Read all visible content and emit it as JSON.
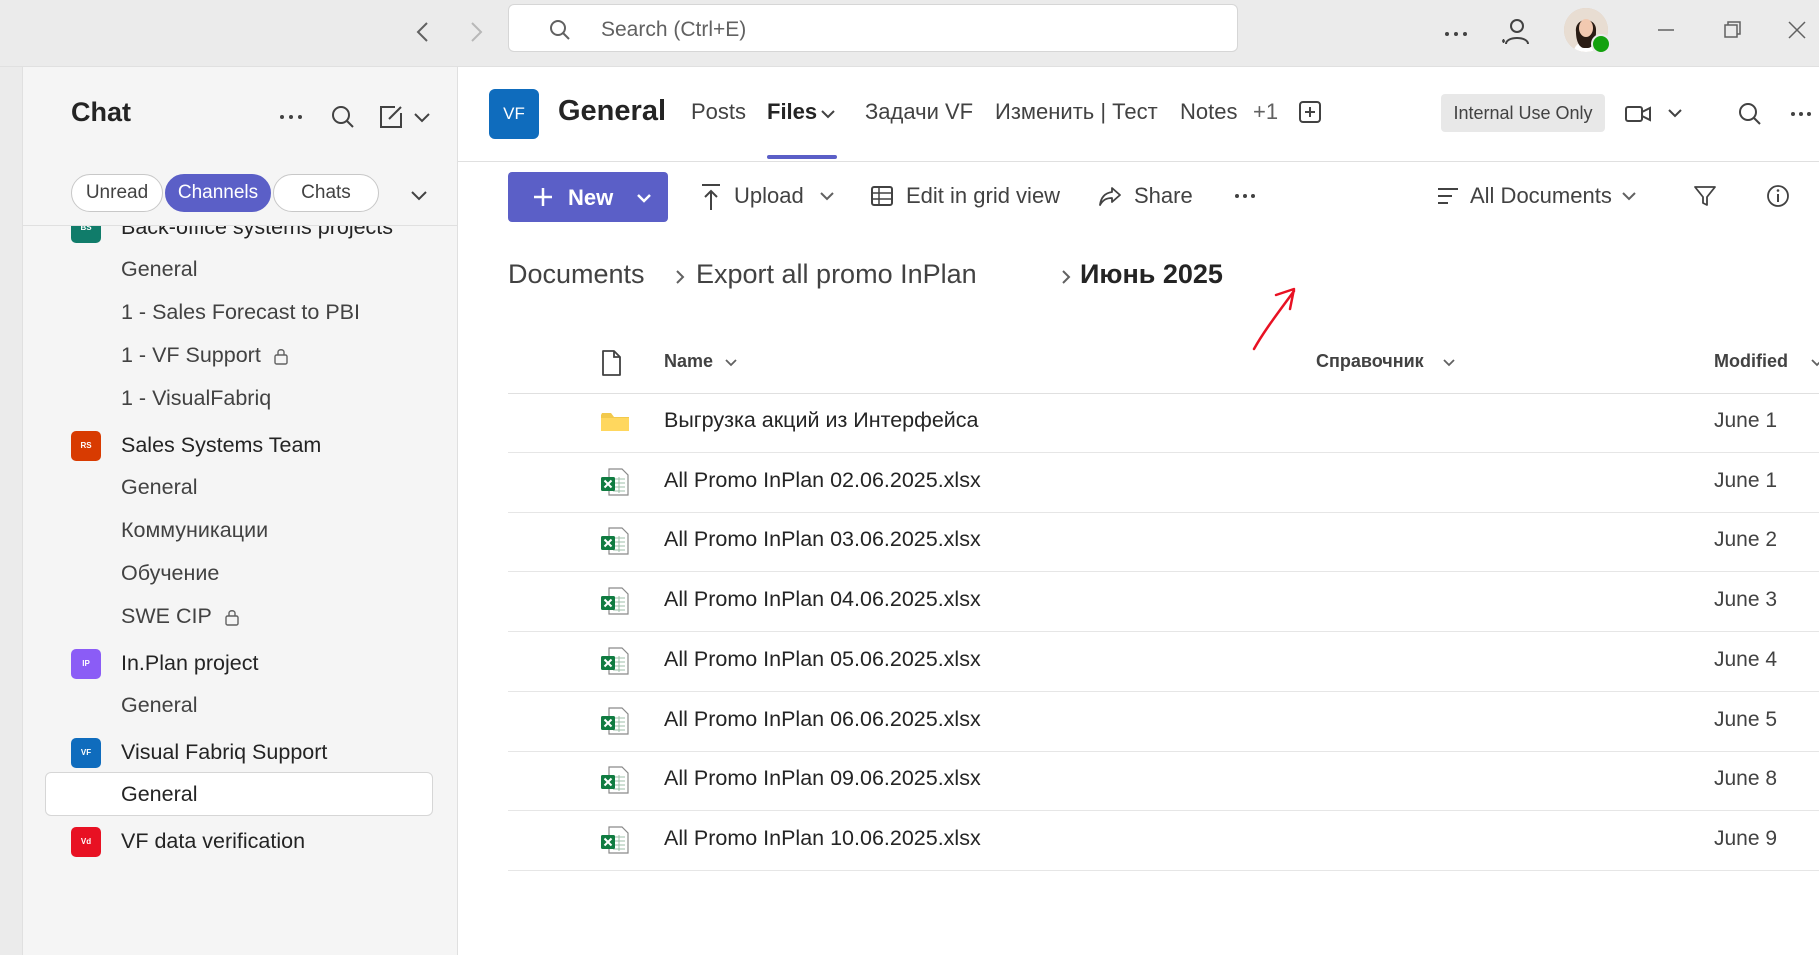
{
  "titlebar": {
    "search_placeholder": "Search (Ctrl+E)",
    "icons": [
      "back-arrow-icon",
      "forward-arrow-icon",
      "search-icon",
      "more-icon",
      "people-icon",
      "avatar",
      "minimize-icon",
      "maximize-icon",
      "close-icon"
    ]
  },
  "sidebar": {
    "title": "Chat",
    "filters": {
      "unread": "Unread",
      "channels": "Channels",
      "chats": "Chats",
      "active": "Channels"
    },
    "teams": [
      {
        "name": "Back-office systems projects",
        "badge": "BS",
        "color": "#107c6a",
        "channels": [
          {
            "name": "General"
          },
          {
            "name": "1 - Sales Forecast to PBI"
          },
          {
            "name": "1 - VF Support",
            "locked": true
          },
          {
            "name": "1 - VisualFabriq"
          }
        ]
      },
      {
        "name": "Sales Systems Team",
        "badge": "RS",
        "color": "#d83b01",
        "channels": [
          {
            "name": "General"
          },
          {
            "name": "Коммуникации"
          },
          {
            "name": "Обучение"
          },
          {
            "name": "SWE CIP",
            "locked": true
          }
        ]
      },
      {
        "name": "In.Plan project",
        "badge": "IP",
        "color": "#8b5cf6",
        "channels": [
          {
            "name": "General"
          }
        ]
      },
      {
        "name": "Visual Fabriq Support",
        "badge": "VF",
        "color": "#0f6cbd",
        "channels": [
          {
            "name": "General",
            "selected": true
          }
        ]
      },
      {
        "name": "VF data verification",
        "badge": "Vd",
        "color": "#e81123",
        "channels": []
      }
    ]
  },
  "header": {
    "team_logo": "VF",
    "channel_title": "General",
    "tabs": [
      "Posts",
      "Files",
      "Задачи VF",
      "Изменить | Тест",
      "Notes",
      "+1"
    ],
    "active_tab": "Files",
    "sensitivity_label": "Internal Use Only"
  },
  "toolbar": {
    "new_label": "New",
    "upload_label": "Upload",
    "grid_label": "Edit in grid view",
    "share_label": "Share",
    "view_label": "All Documents"
  },
  "breadcrumb": [
    "Documents",
    "Export all promo InPlan",
    "Июнь 2025"
  ],
  "table": {
    "columns": {
      "name": "Name",
      "ref": "Справочник",
      "modified": "Modified"
    },
    "rows": [
      {
        "type": "folder",
        "name": "Выгрузка акций из Интерфейса",
        "modified": "June 1"
      },
      {
        "type": "excel",
        "name": "All Promo InPlan 02.06.2025.xlsx",
        "modified": "June 1"
      },
      {
        "type": "excel",
        "name": "All Promo InPlan 03.06.2025.xlsx",
        "modified": "June 2"
      },
      {
        "type": "excel",
        "name": "All Promo InPlan 04.06.2025.xlsx",
        "modified": "June 3"
      },
      {
        "type": "excel",
        "name": "All Promo InPlan 05.06.2025.xlsx",
        "modified": "June 4"
      },
      {
        "type": "excel",
        "name": "All Promo InPlan 06.06.2025.xlsx",
        "modified": "June 5"
      },
      {
        "type": "excel",
        "name": "All Promo InPlan 09.06.2025.xlsx",
        "modified": "June 8"
      },
      {
        "type": "excel",
        "name": "All Promo InPlan 10.06.2025.xlsx",
        "modified": "June 9"
      }
    ]
  },
  "colors": {
    "accent": "#5b5fc7",
    "excel": "#107c41",
    "folder": "#f2c94c",
    "annotation": "#e81123"
  }
}
